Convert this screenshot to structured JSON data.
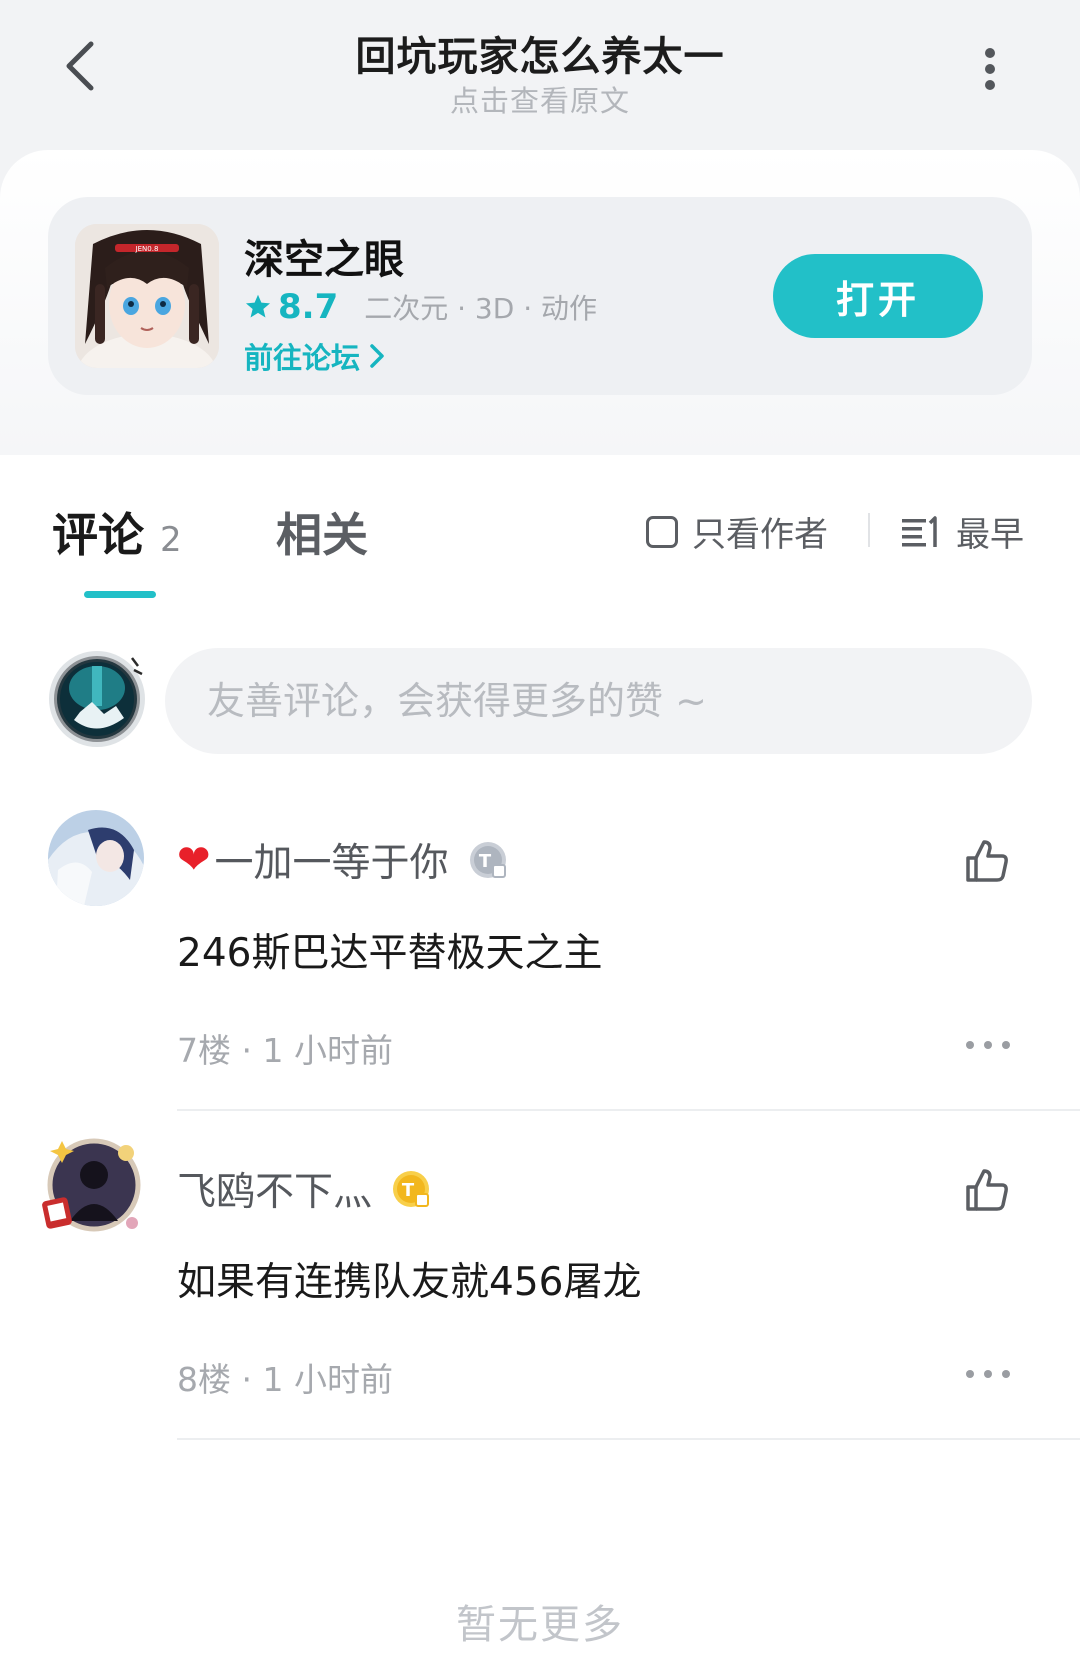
{
  "header": {
    "title": "回坑玩家怎么养太一",
    "subtitle": "点击查看原文"
  },
  "app_card": {
    "name": "深空之眼",
    "rating": "8.7",
    "tags": "二次元 · 3D · 动作",
    "forum_link": "前往论坛",
    "open_button": "打开",
    "icon_banner_text": "JEN0.8"
  },
  "tabs": {
    "comments_label": "评论",
    "comments_count": "2",
    "related_label": "相关",
    "author_only": "只看作者",
    "sort_label": "最早"
  },
  "comment_input": {
    "placeholder": "友善评论，会获得更多的赞 ~"
  },
  "comments": [
    {
      "username": "一加一等于你",
      "has_heart": true,
      "badge_color": "silver",
      "text": "246斯巴达平替极天之主",
      "meta": "7楼 · 1 小时前"
    },
    {
      "username": "飞鸥不下灬",
      "has_heart": false,
      "badge_color": "gold",
      "text": "如果有连携队友就456屠龙",
      "meta": "8楼 · 1 小时前"
    }
  ],
  "footer": {
    "no_more": "暂无更多"
  },
  "colors": {
    "accent": "#22c0c8",
    "accent_text": "#16b5c0",
    "header_bg": "#f2f3f5"
  },
  "icons": [
    "back-icon",
    "more-vertical-icon",
    "star-icon",
    "chevron-right-icon",
    "checkbox-icon",
    "sort-icon",
    "thumbs-up-icon",
    "heart-icon",
    "level-badge-icon",
    "ellipsis-icon"
  ]
}
